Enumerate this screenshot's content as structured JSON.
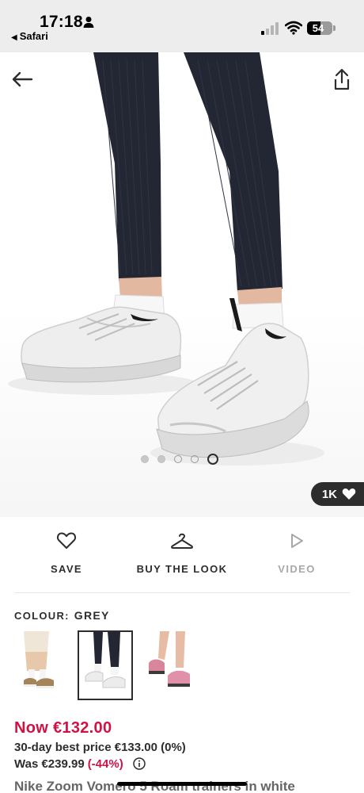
{
  "status_bar": {
    "time": "17:18",
    "back_app": "Safari",
    "battery_percent": 54,
    "battery_label": "54"
  },
  "hero": {
    "icons": [
      "back-arrow-icon",
      "share-icon"
    ],
    "carousel": {
      "total": 5,
      "active_index": 5
    },
    "likes_label": "1K"
  },
  "actions": {
    "save_label": "SAVE",
    "buy_the_look_label": "BUY THE LOOK",
    "video_label": "VIDEO"
  },
  "colour": {
    "label": "COLOUR:",
    "value": "GREY",
    "swatches": [
      "beige-sneaker-swatch",
      "grey-sneaker-swatch",
      "pink-sneaker-swatch"
    ],
    "selected_index": 1
  },
  "price": {
    "now": "Now €132.00",
    "best_price": "30-day best price €133.00 (0%)",
    "was": "Was €239.99",
    "discount": "(-44%)"
  },
  "product": {
    "title": "Nike Zoom Vomero 5 Roam trainers in white"
  },
  "colors": {
    "sale_red": "#d01345",
    "text_dark": "#2d2d2d",
    "status_bar_bg": "#ededed"
  }
}
